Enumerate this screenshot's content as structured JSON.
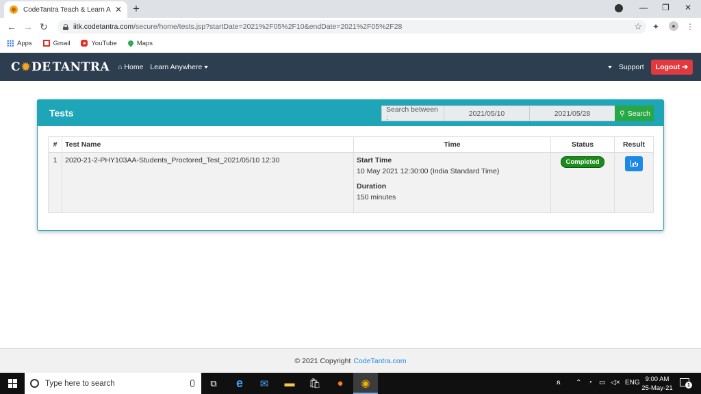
{
  "browser": {
    "tab_title": "CodeTantra Teach & Learn Anyw",
    "url_host": "iitk.codetantra.com",
    "url_path": "/secure/home/tests.jsp?startDate=2021%2F05%2F10&endDate=2021%2F05%2F28",
    "bookmarks": [
      "Apps",
      "Gmail",
      "YouTube",
      "Maps"
    ]
  },
  "navbar": {
    "logo": "CODETANTRA",
    "home": "Home",
    "learn": "Learn Anywhere",
    "support": "Support",
    "logout": "Logout"
  },
  "panel": {
    "title": "Tests",
    "search_label": "Search between :",
    "start_date": "2021/05/10",
    "end_date": "2021/05/28",
    "search_button": "Search"
  },
  "table": {
    "headers": [
      "#",
      "Test Name",
      "Time",
      "Status",
      "Result"
    ],
    "rows": [
      {
        "index": "1",
        "name": "2020-21-2-PHY103AA-Students_Proctored_Test_2021/05/10 12:30",
        "start_label": "Start Time",
        "start_value": "10 May 2021 12:30:00 (India Standard Time)",
        "duration_label": "Duration",
        "duration_value": "150 minutes",
        "status": "Completed"
      }
    ]
  },
  "footer": {
    "text": "© 2021 Copyright",
    "link": "CodeTantra.com"
  },
  "taskbar": {
    "search_placeholder": "Type here to search",
    "language": "ENG",
    "time": "9:00 AM",
    "date": "25-May-21",
    "notifications": "1"
  },
  "colors": {
    "navbar_bg": "#2c3e50",
    "panel_accent": "#1ea5b8",
    "logout": "#e0393e",
    "search_button": "#28a745",
    "status_badge": "#1a8c1a",
    "result_button": "#1e88e5"
  }
}
